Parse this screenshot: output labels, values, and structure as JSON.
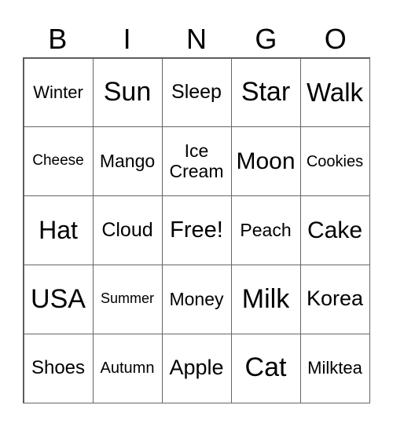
{
  "header": [
    "B",
    "I",
    "N",
    "G",
    "O"
  ],
  "cells": [
    "Winter",
    "Sun",
    "Sleep",
    "Star",
    "Walk",
    "Cheese",
    "Mango",
    "Ice\nCream",
    "Moon",
    "Cookies",
    "Hat",
    "Cloud",
    "Free!",
    "Peach",
    "Cake",
    "USA",
    "Summer",
    "Money",
    "Milk",
    "Korea",
    "Shoes",
    "Autumn",
    "Apple",
    "Cat",
    "Milktea"
  ]
}
